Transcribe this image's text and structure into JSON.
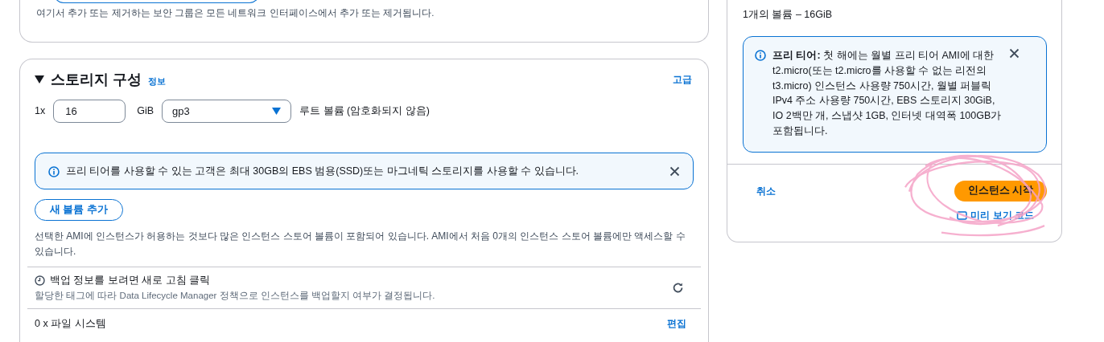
{
  "network_card": {
    "note": "여기서 추가 또는 제거하는 보안 그룹은 모든 네트워크 인터페이스에서 추가 또는 제거됩니다."
  },
  "storage": {
    "expanded": true,
    "title": "스토리지 구성",
    "info_link": "정보",
    "advanced_link": "고급",
    "volume": {
      "count": "1x",
      "size": "16",
      "unit": "GiB",
      "type": "gp3",
      "description": "루트 볼륨  (암호화되지 않음)"
    },
    "alert": {
      "text": "프리 티어를 사용할 수 있는 고객은 최대 30GB의 EBS 범용(SSD)또는 마그네틱 스토리지를 사용할 수 있습니다."
    },
    "add_volume_button": "새 볼륨 추가",
    "note": "선택한 AMI에 인스턴스가 허용하는 것보다 많은 인스턴스 스토어 볼륨이 포함되어 있습니다. AMI에서 처음 0개의 인스턴스 스토어 볼륨에만 액세스할 수 있습니다.",
    "backup": {
      "title": "백업 정보를 보려면 새로 고침 클릭",
      "description": "할당한 태그에 따라 Data Lifecycle Manager 정책으로 인스턴스를 백업할지 여부가 결정됩니다."
    },
    "file_systems": {
      "label": "0 x 파일 시스템",
      "edit_link": "편집"
    }
  },
  "summary": {
    "volumes": "1개의 볼륨 – 16GiB",
    "free_tier_alert": {
      "text": "**프리 티어:** 첫 해에는 월별 프리 티어 AMI에 대한 t2.micro(또는 t2.micro를 사용할 수 없는 리전의 t3.micro) 인스턴스 사용량 750시간, 월별 퍼블릭 IPv4 주소 사용량 750시간, EBS 스토리지 30GiB, IO 2백만 개, 스냅샷 1GB, 인터넷 대역폭 100GB가 포함됩니다."
    },
    "cancel_link": "취소",
    "launch_button": "인스턴스 시작",
    "preview_link": "미리 보기 코드"
  }
}
